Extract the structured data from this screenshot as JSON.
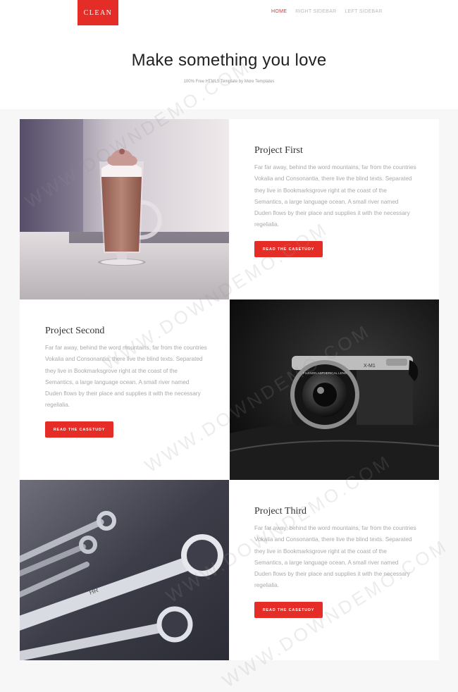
{
  "brand": {
    "logo": "CLEAN"
  },
  "nav": {
    "items": [
      "HOME",
      "RIGHT SIDEBAR",
      "LEFT SIDEBAR"
    ]
  },
  "hero": {
    "title": "Make something you love",
    "subtitle": "100% Free HTML5 Template by More Templates"
  },
  "projects": [
    {
      "title": "Project First",
      "description": "Far far away, behind the word mountains, far from the countries Vokalia and Consonantia, there live the blind texts. Separated they live in Bookmarksgrove right at the coast of the Semantics, a large language ocean. A small river named Duden flows by their place and supplies it with the necessary regelialia.",
      "button": "READ THE CASETUDY"
    },
    {
      "title": "Project Second",
      "description": "Far far away, behind the word mountains, far from the countries Vokalia and Consonantia, there live the blind texts. Separated they live in Bookmarksgrove right at the coast of the Semantics, a large language ocean. A small river named Duden flows by their place and supplies it with the necessary regelialia.",
      "button": "READ THE CASETUDY"
    },
    {
      "title": "Project Third",
      "description": "Far far away, behind the word mountains, far from the countries Vokalia and Consonantia, there live the blind texts. Separated they live in Bookmarksgrove right at the coast of the Semantics, a large language ocean. A small river named Duden flows by their place and supplies it with the necessary regelialia.",
      "button": "READ THE CASETUDY"
    }
  ],
  "camera": {
    "brand": "FUJINON ASPHERICAL LENS",
    "model": "X-M1"
  },
  "wrench": {
    "mark": "HR"
  },
  "watermark": "WWW.DOWNDEMO.COM",
  "colors": {
    "accent": "#e52d27",
    "page_bg": "#f7f7f7",
    "card_bg": "#ffffff",
    "body_text": "#a9a9a9"
  }
}
